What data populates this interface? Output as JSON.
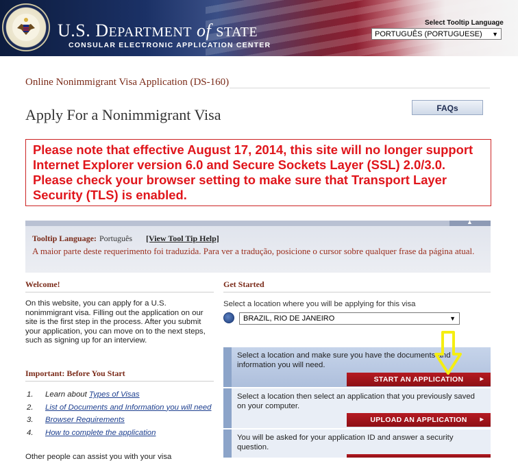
{
  "header": {
    "agency_prefix": "U.S. D",
    "agency_part2": "EPARTMENT",
    "agency_of": " of ",
    "agency_state": "STATE",
    "subtitle": "CONSULAR ELECTRONIC APPLICATION CENTER",
    "tooltip_language_label": "Select Tooltip Language",
    "tooltip_language_value": "PORTUGUÊS (PORTUGUESE)"
  },
  "application_title": "Online Nonimmigrant Visa Application (DS-160)",
  "page_title": "Apply For a Nonimmigrant Visa",
  "faq_label": "FAQs",
  "notice_text": "Please note that effective August 17, 2014, this site will no longer support Internet Explorer version 6.0 and Secure Sockets Layer (SSL) 2.0/3.0. Please check your browser setting to make sure that Transport Layer Security (TLS) is enabled.",
  "tooltip_box": {
    "language_label": "Tooltip Language:",
    "language_value": "Português",
    "help_link": "[View Tool Tip Help]",
    "description": "A maior parte deste requerimento foi traduzida. Para ver a tradução, posicione o cursor sobre qualquer frase da página atual."
  },
  "welcome": {
    "heading": "Welcome!",
    "text": "On this website, you can apply for a U.S. nonimmigrant visa. Filling out the application on our site is the first step in the process. After you submit your application, you can move on to the next steps, such as signing up for an interview."
  },
  "important": {
    "heading": "Important: Before You Start",
    "steps": [
      {
        "num": "1.",
        "prefix": "Learn about ",
        "link": "Types of Visas"
      },
      {
        "num": "2.",
        "prefix": "",
        "link": "List of Documents and Information you will need"
      },
      {
        "num": "3.",
        "prefix": "",
        "link": "Browser Requirements"
      },
      {
        "num": "4.",
        "prefix": "",
        "link": "How to complete the application"
      }
    ],
    "other_text": "Other people can assist you with your visa"
  },
  "get_started": {
    "heading": "Get Started",
    "location_label": "Select a location where you will be applying for this visa",
    "location_value": "BRAZIL, RIO DE JANEIRO",
    "cards": [
      {
        "text": "Select a location and make sure you have the documents and information you will need.",
        "button": "START AN APPLICATION"
      },
      {
        "text": "Select a location then select an application that you previously saved on your computer.",
        "button": "UPLOAD AN APPLICATION"
      },
      {
        "text": "You will be asked for your application ID and answer a security question.",
        "button": ""
      }
    ]
  },
  "colors": {
    "notice_red": "#e0151b",
    "header_navy": "#1b3166",
    "button_red": "#a3161d",
    "heading_brown": "#7a2a18",
    "indicator_yellow": "#f5ee12"
  }
}
